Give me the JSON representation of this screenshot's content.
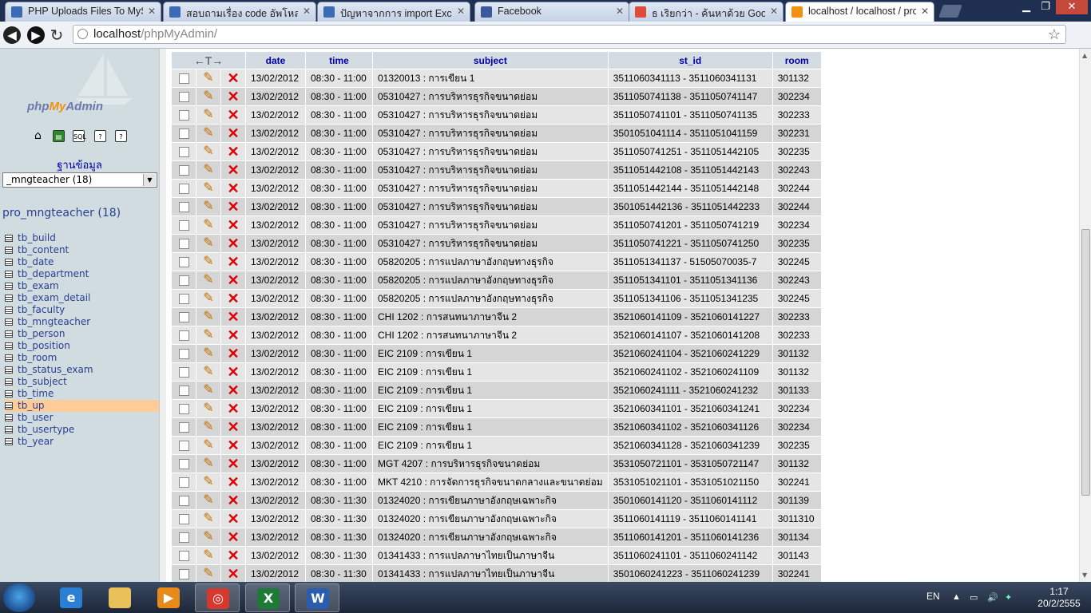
{
  "browser": {
    "tabs": [
      {
        "label": "PHP Uploads Files To MySQ",
        "icon": "forum-icon",
        "color": "#3b6bb5"
      },
      {
        "label": "สอบถามเรื่อง code อัพโหลดไฟ",
        "icon": "forum-icon",
        "color": "#3b6bb5"
      },
      {
        "label": "ปัญหาจากการ import Excel to",
        "icon": "forum-icon",
        "color": "#3b6bb5"
      },
      {
        "label": "Facebook",
        "icon": "facebook-icon",
        "color": "#3b5998"
      },
      {
        "label": "ธ เริยกว่า - ค้นหาด้วย Google",
        "icon": "google-icon",
        "color": "#dd4b39"
      },
      {
        "label": "localhost / localhost / pro_r",
        "icon": "pma-icon",
        "color": "#f29111"
      }
    ],
    "url_host": "localhost",
    "url_path": "/phpMyAdmin/"
  },
  "sidebar": {
    "logo_php": "php",
    "logo_my": "My",
    "logo_admin": "Admin",
    "db_label": "ฐานข้อมูล",
    "db_select": "_mngteacher (18)",
    "db_title": "pro_mngteacher (18)",
    "tables": [
      "tb_build",
      "tb_content",
      "tb_date",
      "tb_department",
      "tb_exam",
      "tb_exam_detail",
      "tb_faculty",
      "tb_mngteacher",
      "tb_person",
      "tb_position",
      "tb_room",
      "tb_status_exam",
      "tb_subject",
      "tb_time",
      "tb_up",
      "tb_user",
      "tb_usertype",
      "tb_year"
    ],
    "selected_table": "tb_up"
  },
  "grid": {
    "header_arrows": "←T→",
    "columns": [
      "date",
      "time",
      "subject",
      "st_id",
      "room"
    ],
    "rows": [
      [
        "13/02/2012",
        "08:30 - 11:00",
        "01320013 : การเขียน 1",
        "3511060341113 - 3511060341131",
        "301132"
      ],
      [
        "13/02/2012",
        "08:30 - 11:00",
        "05310427 : การบริหารธุรกิจขนาดย่อม",
        "3511050741138 - 3511050741147",
        "302234"
      ],
      [
        "13/02/2012",
        "08:30 - 11:00",
        "05310427 : การบริหารธุรกิจขนาดย่อม",
        "3511050741101 - 3511050741135",
        "302233"
      ],
      [
        "13/02/2012",
        "08:30 - 11:00",
        "05310427 : การบริหารธุรกิจขนาดย่อม",
        "3501051041114 - 3511051041159",
        "302231"
      ],
      [
        "13/02/2012",
        "08:30 - 11:00",
        "05310427 : การบริหารธุรกิจขนาดย่อม",
        "3511050741251 - 3511051442105",
        "302235"
      ],
      [
        "13/02/2012",
        "08:30 - 11:00",
        "05310427 : การบริหารธุรกิจขนาดย่อม",
        "3511051442108 - 3511051442143",
        "302243"
      ],
      [
        "13/02/2012",
        "08:30 - 11:00",
        "05310427 : การบริหารธุรกิจขนาดย่อม",
        "3511051442144 - 3511051442148",
        "302244"
      ],
      [
        "13/02/2012",
        "08:30 - 11:00",
        "05310427 : การบริหารธุรกิจขนาดย่อม",
        "3501051442136 - 3511051442233",
        "302244"
      ],
      [
        "13/02/2012",
        "08:30 - 11:00",
        "05310427 : การบริหารธุรกิจขนาดย่อม",
        "3511050741201 - 3511050741219",
        "302234"
      ],
      [
        "13/02/2012",
        "08:30 - 11:00",
        "05310427 : การบริหารธุรกิจขนาดย่อม",
        "3511050741221 - 3511050741250",
        "302235"
      ],
      [
        "13/02/2012",
        "08:30 - 11:00",
        "05820205 : การแปลภาษาอังกฤษทางธุรกิจ",
        "3511051341137 - 51505070035-7",
        "302245"
      ],
      [
        "13/02/2012",
        "08:30 - 11:00",
        "05820205 : การแปลภาษาอังกฤษทางธุรกิจ",
        "3511051341101 - 3511051341136",
        "302243"
      ],
      [
        "13/02/2012",
        "08:30 - 11:00",
        "05820205 : การแปลภาษาอังกฤษทางธุรกิจ",
        "3511051341106 - 3511051341235",
        "302245"
      ],
      [
        "13/02/2012",
        "08:30 - 11:00",
        "CHI 1202 : การสนทนาภาษาจีน 2",
        "3521060141109 - 3521060141227",
        "302233"
      ],
      [
        "13/02/2012",
        "08:30 - 11:00",
        "CHI 1202 : การสนทนาภาษาจีน 2",
        "3521060141107 - 3521060141208",
        "302233"
      ],
      [
        "13/02/2012",
        "08:30 - 11:00",
        "EIC 2109 : การเขียน 1",
        "3521060241104 - 3521060241229",
        "301132"
      ],
      [
        "13/02/2012",
        "08:30 - 11:00",
        "EIC 2109 : การเขียน 1",
        "3521060241102 - 3521060241109",
        "301132"
      ],
      [
        "13/02/2012",
        "08:30 - 11:00",
        "EIC 2109 : การเขียน 1",
        "3521060241111 - 3521060241232",
        "301133"
      ],
      [
        "13/02/2012",
        "08:30 - 11:00",
        "EIC 2109 : การเขียน 1",
        "3521060341101 - 3521060341241",
        "302234"
      ],
      [
        "13/02/2012",
        "08:30 - 11:00",
        "EIC 2109 : การเขียน 1",
        "3521060341102 - 3521060341126",
        "302234"
      ],
      [
        "13/02/2012",
        "08:30 - 11:00",
        "EIC 2109 : การเขียน 1",
        "3521060341128 - 3521060341239",
        "302235"
      ],
      [
        "13/02/2012",
        "08:30 - 11:00",
        "MGT 4207 : การบริหารธุรกิจขนาดย่อม",
        "3531050721101 - 3531050721147",
        "301132"
      ],
      [
        "13/02/2012",
        "08:30 - 11:00",
        "MKT 4210 : การจัดการธุรกิจขนาดกลางและขนาดย่อม",
        "3531051021101 - 3531051021150",
        "302241"
      ],
      [
        "13/02/2012",
        "08:30 - 11:30",
        "01324020 : การเขียนภาษาอังกฤษเฉพาะกิจ",
        "3501060141120 - 3511060141112",
        "301139"
      ],
      [
        "13/02/2012",
        "08:30 - 11:30",
        "01324020 : การเขียนภาษาอังกฤษเฉพาะกิจ",
        "3511060141119 - 3511060141141",
        "3011310"
      ],
      [
        "13/02/2012",
        "08:30 - 11:30",
        "01324020 : การเขียนภาษาอังกฤษเฉพาะกิจ",
        "3511060141201 - 3511060141236",
        "301134"
      ],
      [
        "13/02/2012",
        "08:30 - 11:30",
        "01341433 : การแปลภาษาไทยเป็นภาษาจีน",
        "3511060241101 - 3511060241142",
        "301143"
      ],
      [
        "13/02/2012",
        "08:30 - 11:30",
        "01341433 : การแปลภาษาไทยเป็นภาษาจีน",
        "3501060241223 - 3511060241239",
        "302241"
      ]
    ]
  },
  "taskbar": {
    "apps": [
      {
        "name": "ie-icon",
        "letter": "e",
        "color": "#2a7fd4"
      },
      {
        "name": "explorer-icon",
        "letter": "",
        "color": "#e8c15a"
      },
      {
        "name": "media-player-icon",
        "letter": "▶",
        "color": "#e88a1a"
      },
      {
        "name": "chrome-icon",
        "letter": "◎",
        "color": "#d6382c"
      },
      {
        "name": "excel-icon",
        "letter": "X",
        "color": "#1f7a3a"
      },
      {
        "name": "word-icon",
        "letter": "W",
        "color": "#2a5db0"
      }
    ],
    "lang": "EN",
    "time": "1:17",
    "date": "20/2/2555"
  }
}
